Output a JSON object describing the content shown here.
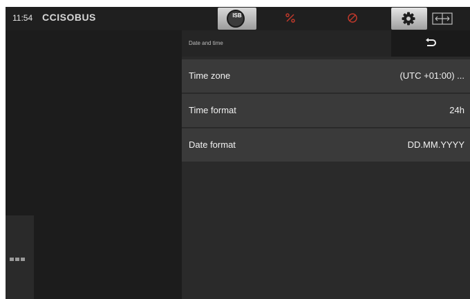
{
  "status_bar": {
    "time": "11:54",
    "logo": "CCISOBUS",
    "isb_label": "ISB",
    "icons": [
      "isb-icon",
      "percent-off-icon",
      "no-drive-icon",
      "gear-icon",
      "swap-screen-icon"
    ]
  },
  "settings": {
    "header_title": "Date and time",
    "rows": [
      {
        "label": "Time zone",
        "value": "(UTC +01:00) ..."
      },
      {
        "label": "Time format",
        "value": "24h"
      },
      {
        "label": "Date format",
        "value": "DD.MM.YYYY"
      }
    ]
  },
  "colors": {
    "background": "#1f1f1f",
    "row": "#3a3a3a",
    "accent_red": "#c0392b"
  }
}
